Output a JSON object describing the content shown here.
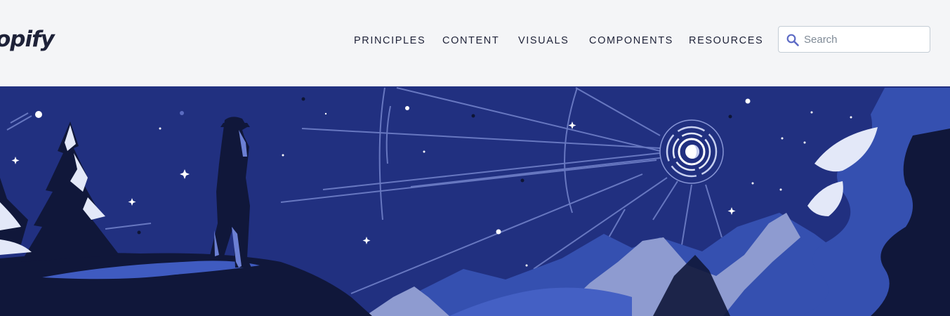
{
  "header": {
    "logo_text": "opify"
  },
  "nav": {
    "items": [
      {
        "label": "PRINCIPLES"
      },
      {
        "label": "CONTENT"
      },
      {
        "label": "VISUALS"
      },
      {
        "label": "COMPONENTS"
      },
      {
        "label": "RESOURCES"
      }
    ]
  },
  "search": {
    "placeholder": "Search",
    "value": "",
    "icon": "search-icon"
  },
  "hero": {
    "illustration": "night-sky-explorer-illustration",
    "colors": {
      "sky": "#213080",
      "mountain_light": "#8e9bd0",
      "mountain_mid": "#3550b0",
      "foreground": "#10173a",
      "snow": "#e3e8f8"
    }
  }
}
